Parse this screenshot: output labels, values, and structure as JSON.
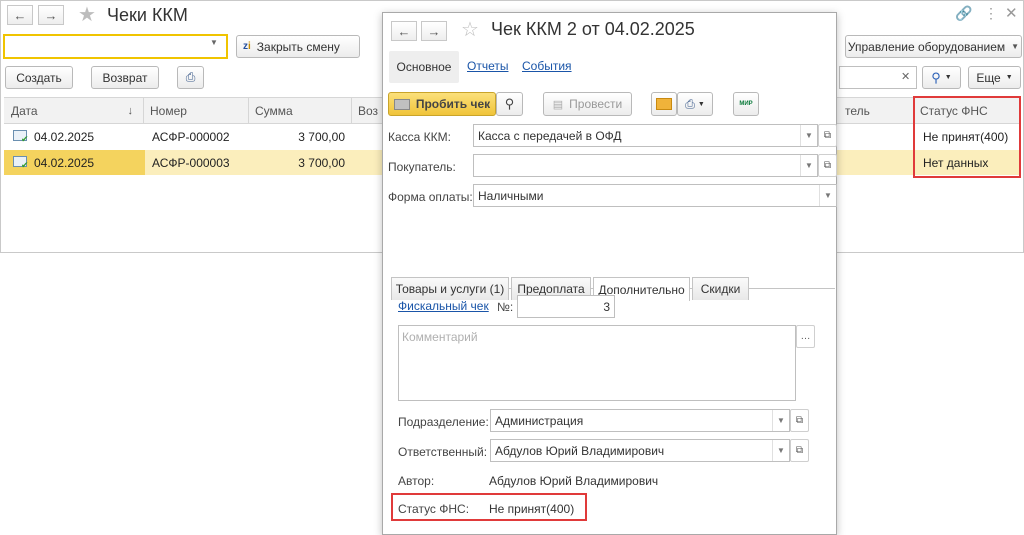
{
  "list_window": {
    "title": "Чеки ККМ",
    "close_shift_label": "Закрыть смену",
    "equipment_label": "Управление оборудованием",
    "create_label": "Создать",
    "return_label": "Возврат",
    "more_label": "Еще",
    "columns": [
      "Дата",
      "Номер",
      "Сумма",
      "Воз",
      "тель",
      "Статус ФНС"
    ],
    "rows": [
      {
        "date": "04.02.2025",
        "number": "АСФР-000002",
        "sum": "3 700,00",
        "status": "Не принят(400)"
      },
      {
        "date": "04.02.2025",
        "number": "АСФР-000003",
        "sum": "3 700,00",
        "status": "Нет данных"
      }
    ]
  },
  "doc_window": {
    "title": "Чек ККМ 2 от 04.02.2025",
    "nav_tabs": [
      "Основное",
      "Отчеты",
      "События"
    ],
    "punch_label": "Пробить чек",
    "post_label": "Провести",
    "mir_label": "МИР",
    "fields": {
      "kassa_label": "Касса ККМ:",
      "kassa_value": "Касса с передачей в ОФД",
      "buyer_label": "Покупатель:",
      "buyer_value": "",
      "payment_label": "Форма оплаты:",
      "payment_value": "Наличными"
    },
    "tabs": [
      "Товары и услуги (1)",
      "Предоплата",
      "Дополнительно",
      "Скидки"
    ],
    "fiscal_link": "Фискальный чек",
    "number_label": "№:",
    "number_value": "3",
    "comment_placeholder": "Комментарий",
    "division_label": "Подразделение:",
    "division_value": "Администрация",
    "responsible_label": "Ответственный:",
    "responsible_value": "Абдулов Юрий Владимирович",
    "author_label": "Автор:",
    "author_value": "Абдулов Юрий Владимирович",
    "fns_label": "Статус ФНС:",
    "fns_value": "Не принят(400)"
  },
  "colors": {
    "accent_yellow": "#f4d35e",
    "selected_row": "#fbeebc",
    "highlight_red": "#e03a3a",
    "link_blue": "#1a55a8"
  }
}
